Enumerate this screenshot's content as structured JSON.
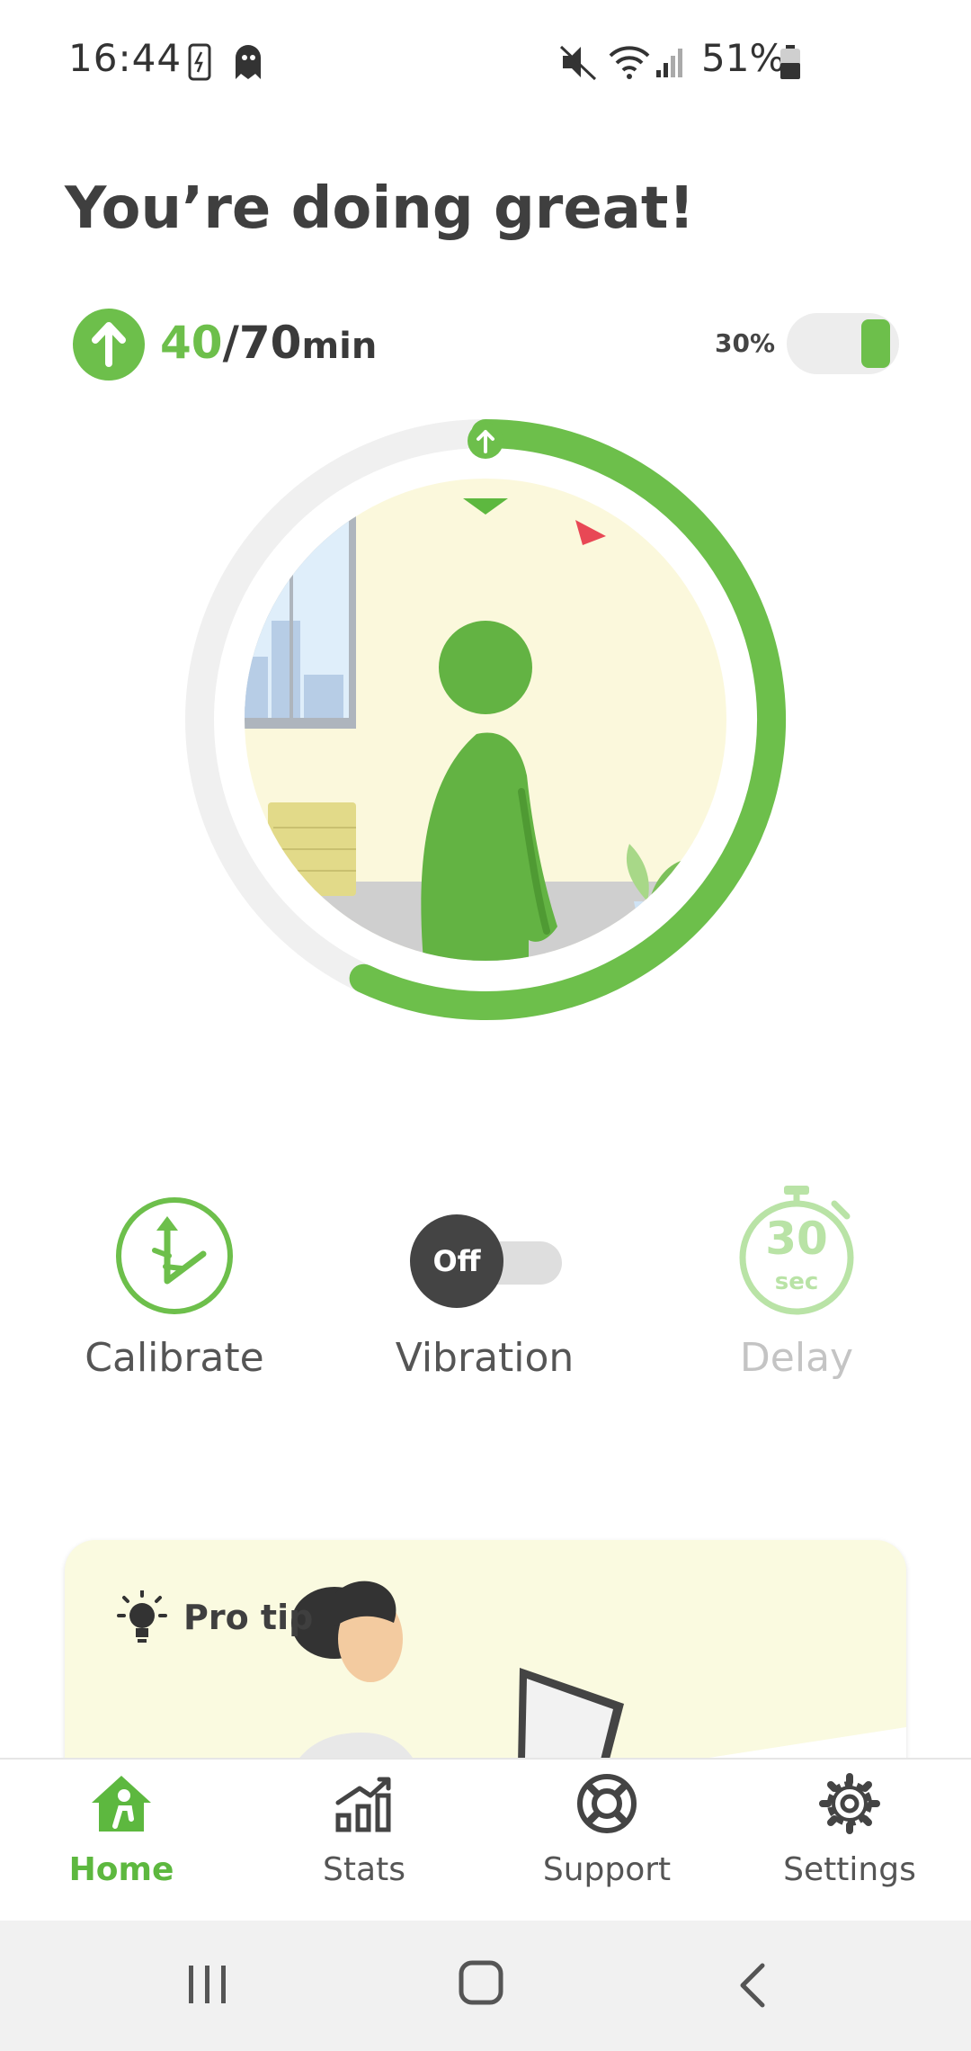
{
  "status_bar": {
    "time": "16:44",
    "battery": "51%",
    "icons": [
      "phone-charge-icon",
      "app-ghost-icon",
      "mute-icon",
      "wifi-icon",
      "signal-icon",
      "battery-icon"
    ]
  },
  "header": {
    "title": "You’re doing great!"
  },
  "progress": {
    "done": "40",
    "total": "/70",
    "unit": "min",
    "sensitivity_label": "30%",
    "ring_fraction": 0.57
  },
  "controls": {
    "calibrate_label": "Calibrate",
    "vibration_label": "Vibration",
    "vibration_state": "Off",
    "delay_label": "Delay",
    "delay_value": "30",
    "delay_unit": "sec"
  },
  "tip": {
    "title": "Pro tip"
  },
  "nav": {
    "items": [
      {
        "label": "Home",
        "icon": "home-icon",
        "active": true
      },
      {
        "label": "Stats",
        "icon": "stats-icon",
        "active": false
      },
      {
        "label": "Support",
        "icon": "lifebuoy-icon",
        "active": false
      },
      {
        "label": "Settings",
        "icon": "gear-icon",
        "active": false
      }
    ]
  },
  "colors": {
    "accent": "#6dbf4b",
    "room_wall": "#fbf8dc",
    "alert": "#e84855"
  }
}
